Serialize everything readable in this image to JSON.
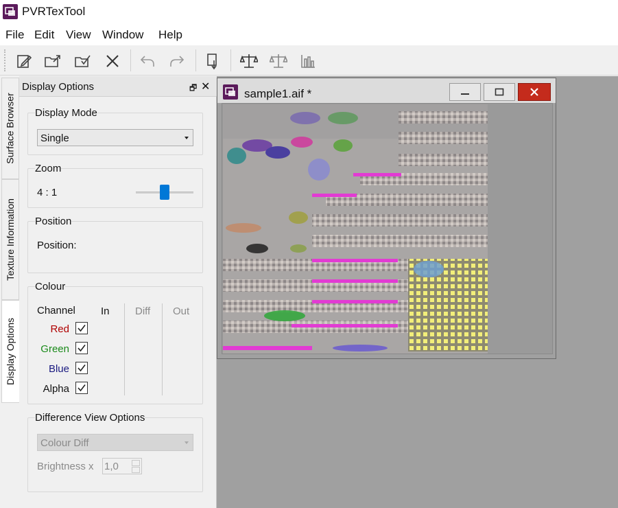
{
  "app": {
    "title": "PVRTexTool"
  },
  "menu": [
    "File",
    "Edit",
    "View",
    "Window",
    "Help"
  ],
  "toolbar": {
    "buttons": [
      {
        "name": "new-file-icon"
      },
      {
        "name": "open-file-icon"
      },
      {
        "name": "save-file-icon"
      },
      {
        "name": "close-icon"
      },
      {
        "name": "undo-icon"
      },
      {
        "name": "redo-icon"
      },
      {
        "name": "encode-icon"
      },
      {
        "name": "compare-icon"
      },
      {
        "name": "compare-alt-icon"
      },
      {
        "name": "histogram-icon"
      }
    ]
  },
  "side_tabs": [
    "Surface Browser",
    "Texture Information",
    "Display Options"
  ],
  "panel": {
    "title": "Display Options",
    "display_mode": {
      "label": "Display Mode",
      "value": "Single"
    },
    "zoom": {
      "label": "Zoom",
      "value": "4 : 1",
      "level": 0.5
    },
    "position": {
      "label": "Position",
      "text": "Position:"
    },
    "colour": {
      "label": "Colour",
      "headers": {
        "channel": "Channel",
        "in": "In",
        "diff": "Diff",
        "out": "Out"
      },
      "channels": [
        {
          "label": "Red",
          "color": "#b00000",
          "checked": true
        },
        {
          "label": "Green",
          "color": "#1a8a1a",
          "checked": true
        },
        {
          "label": "Blue",
          "color": "#1a1a80",
          "checked": true
        },
        {
          "label": "Alpha",
          "color": "#111111",
          "checked": true
        }
      ]
    },
    "difference": {
      "label": "Difference View Options",
      "mode": "Colour Diff",
      "brightness_label": "Brightness x",
      "brightness_value": "1,0"
    }
  },
  "document": {
    "title": "sample1.aif *"
  }
}
